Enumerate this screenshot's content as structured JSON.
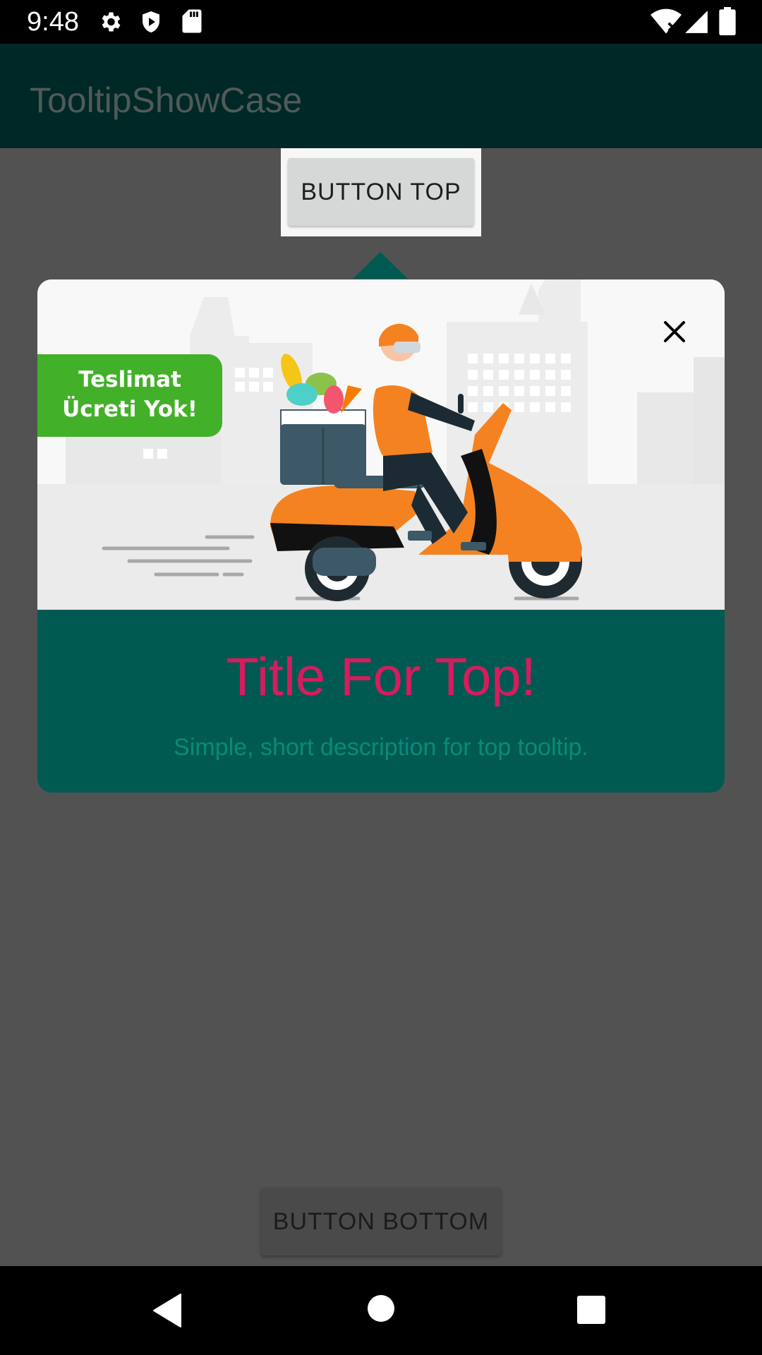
{
  "status_bar": {
    "time": "9:48",
    "left_icons": [
      "gear-icon",
      "shield-play-icon",
      "sd-card-icon"
    ],
    "right_icons": [
      "wifi-icon",
      "signal-icon",
      "battery-icon"
    ]
  },
  "app_bar": {
    "title": "TooltipShowCase"
  },
  "buttons": {
    "top_label": "BUTTON TOP",
    "bottom_label": "BUTTON BOTTOM"
  },
  "tooltip": {
    "badge_line1": "Teslimat",
    "badge_line2": "Ücreti Yok!",
    "title": "Title For Top!",
    "description": "Simple, short description for top tooltip.",
    "close_icon": "close-icon",
    "colors": {
      "background": "#005a51",
      "title": "#d81b5f",
      "description": "#088a7b",
      "badge": "#43b02a"
    }
  },
  "nav_bar": {
    "icons": [
      "back-icon",
      "home-icon",
      "recents-icon"
    ]
  },
  "colors": {
    "app_bar": "#002826",
    "scrim": "#525252"
  }
}
